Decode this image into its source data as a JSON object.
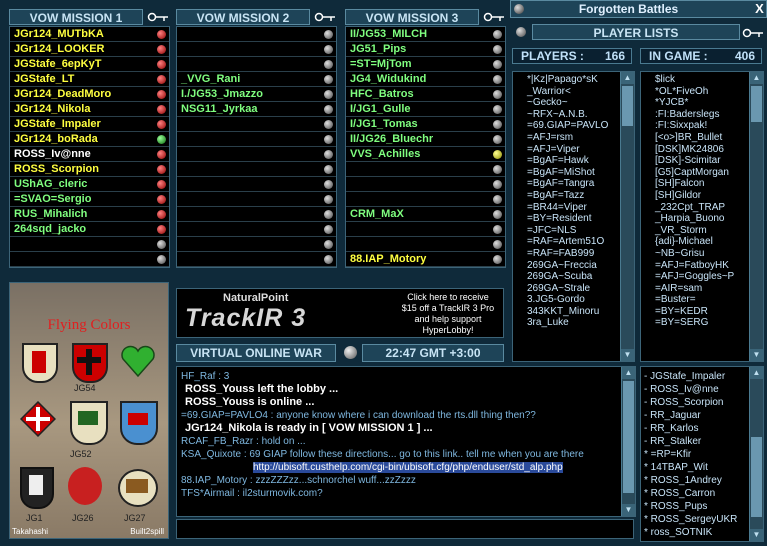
{
  "missions": [
    {
      "title": "VOW MISSION 1",
      "rows": [
        {
          "name": "JGr124_MUTbKA",
          "color": "yellow",
          "dot": "red"
        },
        {
          "name": "JGr124_LOOKER",
          "color": "yellow",
          "dot": "red"
        },
        {
          "name": "JGStafe_6epKyT",
          "color": "yellow",
          "dot": "red"
        },
        {
          "name": "JGStafe_LT",
          "color": "yellow",
          "dot": "red"
        },
        {
          "name": "JGr124_DeadMoro",
          "color": "yellow",
          "dot": "red"
        },
        {
          "name": "JGr124_Nikola",
          "color": "yellow",
          "dot": "red"
        },
        {
          "name": "JGStafe_Impaler",
          "color": "yellow",
          "dot": "red"
        },
        {
          "name": "JGr124_boRada",
          "color": "yellow",
          "dot": "green"
        },
        {
          "name": "ROSS_Iv@nne",
          "color": "white",
          "dot": "red"
        },
        {
          "name": "ROSS_Scorpion",
          "color": "yellow",
          "dot": "red"
        },
        {
          "name": "UShAG_cleric",
          "color": "green",
          "dot": "red"
        },
        {
          "name": "=SVAO=Sergio",
          "color": "green",
          "dot": "red"
        },
        {
          "name": "RUS_Mihalich",
          "color": "green",
          "dot": "red"
        },
        {
          "name": "264sqd_jacko",
          "color": "green",
          "dot": "red"
        },
        {
          "name": "",
          "color": "green",
          "dot": "grey"
        },
        {
          "name": "",
          "color": "green",
          "dot": "grey"
        }
      ]
    },
    {
      "title": "VOW MISSION 2",
      "rows": [
        {
          "name": "",
          "color": "green",
          "dot": "grey"
        },
        {
          "name": "",
          "color": "green",
          "dot": "grey"
        },
        {
          "name": "",
          "color": "green",
          "dot": "grey"
        },
        {
          "name": "_VVG_Rani",
          "color": "green",
          "dot": "grey"
        },
        {
          "name": "I./JG53_Jmazzo",
          "color": "green",
          "dot": "grey"
        },
        {
          "name": "NSG11_Jyrkaa",
          "color": "green",
          "dot": "grey"
        },
        {
          "name": "",
          "color": "green",
          "dot": "grey"
        },
        {
          "name": "",
          "color": "green",
          "dot": "grey"
        },
        {
          "name": "",
          "color": "green",
          "dot": "grey"
        },
        {
          "name": "",
          "color": "green",
          "dot": "grey"
        },
        {
          "name": "",
          "color": "green",
          "dot": "grey"
        },
        {
          "name": "",
          "color": "green",
          "dot": "grey"
        },
        {
          "name": "",
          "color": "green",
          "dot": "grey"
        },
        {
          "name": "",
          "color": "green",
          "dot": "grey"
        },
        {
          "name": "",
          "color": "green",
          "dot": "grey"
        },
        {
          "name": "",
          "color": "green",
          "dot": "grey"
        }
      ]
    },
    {
      "title": "VOW MISSION 3",
      "rows": [
        {
          "name": "II/JG53_MILCH",
          "color": "green",
          "dot": "grey"
        },
        {
          "name": "JG51_Pips",
          "color": "green",
          "dot": "grey"
        },
        {
          "name": "=ST=MjTom",
          "color": "green",
          "dot": "grey"
        },
        {
          "name": "JG4_Widukind",
          "color": "green",
          "dot": "grey"
        },
        {
          "name": "HFC_Batros",
          "color": "green",
          "dot": "grey"
        },
        {
          "name": "I/JG1_Gulle",
          "color": "green",
          "dot": "grey"
        },
        {
          "name": "I/JG1_Tomas",
          "color": "green",
          "dot": "grey"
        },
        {
          "name": "II/JG26_Bluechr",
          "color": "green",
          "dot": "grey"
        },
        {
          "name": "VVS_Achilles",
          "color": "green",
          "dot": "yellow"
        },
        {
          "name": "",
          "color": "green",
          "dot": "grey"
        },
        {
          "name": "",
          "color": "green",
          "dot": "grey"
        },
        {
          "name": "",
          "color": "green",
          "dot": "grey"
        },
        {
          "name": "CRM_MaX",
          "color": "green",
          "dot": "grey"
        },
        {
          "name": "",
          "color": "green",
          "dot": "grey"
        },
        {
          "name": "",
          "color": "green",
          "dot": "grey"
        },
        {
          "name": "88.IAP_Motory",
          "color": "yellow",
          "dot": "grey"
        }
      ]
    }
  ],
  "header": {
    "app_title": "Forgotten Battles",
    "player_lists": "PLAYER LISTS",
    "close": "X"
  },
  "players": {
    "label": "PLAYERS :",
    "count": "166"
  },
  "ingame": {
    "label": "IN GAME :",
    "count": "406"
  },
  "players_list": [
    "*|Kz|Papago*sK",
    "_Warrior<",
    "~Gecko~",
    "~RFX~A.N.B.",
    "=69.GIAP=PAVLO",
    "=AFJ=rsm",
    "=AFJ=Viper",
    "=BgAF=Hawk",
    "=BgAF=MiShot",
    "=BgAF=Tangra",
    "=BgAF=Tazz",
    "=BR44=Viper",
    "=BY=Resident",
    "=JFC=NLS",
    "=RAF=Artem51O",
    "=RAF=FAB999",
    "269GA~Freccia",
    "269GA~Scuba",
    "269GA~Strale",
    "3.JG5-Gordo",
    "343KKT_Minoru",
    "3ra_Luke"
  ],
  "ingame_list": [
    "$lick",
    "*OL*FiveOh",
    "*YJCB*",
    ":FI:Baderslegs",
    ":FI:Sixxpak!",
    "[<o>]BR_Bullet",
    "[DSK]MK24806",
    "[DSK]-Scimitar",
    "[G5]CaptMorgan",
    "[SH]Falcon",
    "[SH]Gildor",
    "_232Cpt_TRAP",
    "_Harpia_Buono",
    "_VR_Storm",
    "{adi}-Michael",
    "~NB~Grisu",
    "=AFJ=FatboyHK",
    "=AFJ=Goggles~P",
    "=AIR=sam",
    "=Buster=",
    "=BY=KEDR",
    "=BY=SERG"
  ],
  "room_list": [
    "-  JGStafe_Impaler",
    "-  ROSS_Iv@nne",
    "-  ROSS_Scorpion",
    "-  RR_Jaguar",
    "-  RR_Karlos",
    "-  RR_Stalker",
    "*  =RP=Kfir",
    "*  14TBAP_Wit",
    "*  ROSS_1Andrey",
    "*  ROSS_Carron",
    "*  ROSS_Pups",
    "*  ROSS_SergeyUKR",
    "*  ross_SOTNIK"
  ],
  "flying_colors": {
    "title": "Flying Colors",
    "labels": [
      "JG54",
      "JG52",
      "JG1",
      "JG26",
      "JG27"
    ],
    "credits_left": "Takahashi",
    "credits_right": "Built2spill"
  },
  "trackir": {
    "brand": "NaturalPoint",
    "name": "TrackIR 3",
    "promo": "Click here to receive $15 off a TrackIR 3 Pro and help support HyperLobby!"
  },
  "vow_bar": {
    "label": "VIRTUAL ONLINE WAR",
    "time": "22:47 GMT +3:00"
  },
  "chat": [
    {
      "text": "HF_Raf : 3",
      "type": "msg"
    },
    {
      "text": "ROSS_Youss left the lobby ...",
      "type": "sys"
    },
    {
      "text": "ROSS_Youss is online ...",
      "type": "sys"
    },
    {
      "text": "=69.GIAP=PAVLO4 : anyone know where i can download the rts.dll thing then??",
      "type": "msg"
    },
    {
      "text": "JGr124_Nikola is ready in  [ VOW MISSION 1 ] ...",
      "type": "sys"
    },
    {
      "text": "RCAF_FB_Razr : hold on ...",
      "type": "msg"
    },
    {
      "text": "KSA_Quixote : 69 GIAP follow these directions... go to this link.. tell me when you are there",
      "type": "msg"
    },
    {
      "text": "http://ubisoft.custhelp.com/cgi-bin/ubisoft.cfg/php/enduser/std_alp.php",
      "type": "link"
    },
    {
      "text": "88.IAP_Motory : zzzZZZzz...schnorchel wuff...zzZzzz",
      "type": "msg"
    },
    {
      "text": "TFS*Airmail : il2sturmovik.com?",
      "type": "msg"
    }
  ],
  "colors": {
    "accent": "#1e4458",
    "yellow": "#ffff40",
    "green": "#80ff80",
    "link": "#2a4a9a"
  }
}
